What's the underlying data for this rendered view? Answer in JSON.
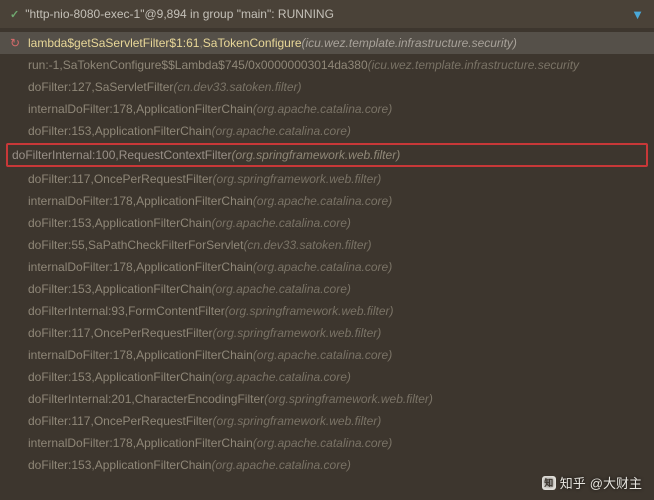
{
  "header": {
    "status_prefix": "✓",
    "text": "\"http-nio-8080-exec-1\"@9,894 in group \"main\": RUNNING"
  },
  "frames": [
    {
      "top": true,
      "method": "lambda$getSaServletFilter$1:61",
      "class": "SaTokenConfigure",
      "pkg": "(icu.wez.template.infrastructure.security)"
    },
    {
      "method": "run:-1",
      "class": "SaTokenConfigure$$Lambda$745/0x00000003014da380",
      "pkg": "(icu.wez.template.infrastructure.security"
    },
    {
      "method": "doFilter:127",
      "class": "SaServletFilter",
      "pkg": "(cn.dev33.satoken.filter)"
    },
    {
      "method": "internalDoFilter:178",
      "class": "ApplicationFilterChain",
      "pkg": "(org.apache.catalina.core)"
    },
    {
      "method": "doFilter:153",
      "class": "ApplicationFilterChain",
      "pkg": "(org.apache.catalina.core)"
    },
    {
      "highlighted": true,
      "method": "doFilterInternal:100",
      "class": "RequestContextFilter",
      "pkg": "(org.springframework.web.filter)"
    },
    {
      "method": "doFilter:117",
      "class": "OncePerRequestFilter",
      "pkg": "(org.springframework.web.filter)"
    },
    {
      "method": "internalDoFilter:178",
      "class": "ApplicationFilterChain",
      "pkg": "(org.apache.catalina.core)"
    },
    {
      "method": "doFilter:153",
      "class": "ApplicationFilterChain",
      "pkg": "(org.apache.catalina.core)"
    },
    {
      "method": "doFilter:55",
      "class": "SaPathCheckFilterForServlet",
      "pkg": "(cn.dev33.satoken.filter)"
    },
    {
      "method": "internalDoFilter:178",
      "class": "ApplicationFilterChain",
      "pkg": "(org.apache.catalina.core)"
    },
    {
      "method": "doFilter:153",
      "class": "ApplicationFilterChain",
      "pkg": "(org.apache.catalina.core)"
    },
    {
      "method": "doFilterInternal:93",
      "class": "FormContentFilter",
      "pkg": "(org.springframework.web.filter)"
    },
    {
      "method": "doFilter:117",
      "class": "OncePerRequestFilter",
      "pkg": "(org.springframework.web.filter)"
    },
    {
      "method": "internalDoFilter:178",
      "class": "ApplicationFilterChain",
      "pkg": "(org.apache.catalina.core)"
    },
    {
      "method": "doFilter:153",
      "class": "ApplicationFilterChain",
      "pkg": "(org.apache.catalina.core)"
    },
    {
      "method": "doFilterInternal:201",
      "class": "CharacterEncodingFilter",
      "pkg": "(org.springframework.web.filter)"
    },
    {
      "method": "doFilter:117",
      "class": "OncePerRequestFilter",
      "pkg": "(org.springframework.web.filter)"
    },
    {
      "method": "internalDoFilter:178",
      "class": "ApplicationFilterChain",
      "pkg": "(org.apache.catalina.core)"
    },
    {
      "method": "doFilter:153",
      "class": "ApplicationFilterChain",
      "pkg": "(org.apache.catalina.core)"
    }
  ],
  "watermark": {
    "site": "知乎",
    "user": "@大财主"
  },
  "icons": {
    "filter": "▼",
    "rerun": "↻"
  }
}
